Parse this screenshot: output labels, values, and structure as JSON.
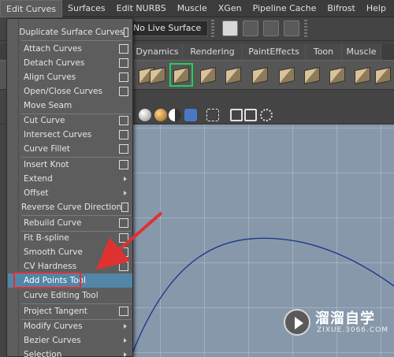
{
  "menubar": {
    "items": [
      {
        "label": "Edit Curves",
        "active": true
      },
      {
        "label": "Surfaces"
      },
      {
        "label": "Edit NURBS"
      },
      {
        "label": "Muscle"
      },
      {
        "label": "XGen"
      },
      {
        "label": "Pipeline Cache"
      },
      {
        "label": "Bifrost"
      },
      {
        "label": "Help"
      }
    ]
  },
  "statusline": {
    "live_surface": "No Live Surface"
  },
  "shelf": {
    "tabs": [
      "Dynamics",
      "Rendering",
      "PaintEffects",
      "Toon",
      "Muscle"
    ]
  },
  "menu": {
    "items": [
      {
        "label": "Duplicate Surface Curves",
        "kind": "option"
      },
      {
        "label": "Attach Curves",
        "kind": "option"
      },
      {
        "label": "Detach Curves",
        "kind": "option"
      },
      {
        "label": "Align Curves",
        "kind": "option"
      },
      {
        "label": "Open/Close Curves",
        "kind": "option"
      },
      {
        "label": "Move Seam",
        "kind": "plain"
      },
      {
        "label": "Cut Curve",
        "kind": "option"
      },
      {
        "label": "Intersect Curves",
        "kind": "option"
      },
      {
        "label": "Curve Fillet",
        "kind": "option"
      },
      {
        "label": "Insert Knot",
        "kind": "option"
      },
      {
        "label": "Extend",
        "kind": "submenu"
      },
      {
        "label": "Offset",
        "kind": "submenu"
      },
      {
        "label": "Reverse Curve Direction",
        "kind": "option"
      },
      {
        "label": "Rebuild Curve",
        "kind": "option"
      },
      {
        "label": "Fit B-spline",
        "kind": "option"
      },
      {
        "label": "Smooth Curve",
        "kind": "option"
      },
      {
        "label": "CV Hardness",
        "kind": "option"
      },
      {
        "label": "Add Points Tool",
        "kind": "plain",
        "highlighted": true
      },
      {
        "label": "Curve Editing Tool",
        "kind": "plain"
      },
      {
        "label": "Project Tangent",
        "kind": "option"
      },
      {
        "label": "Modify Curves",
        "kind": "submenu"
      },
      {
        "label": "Bezier Curves",
        "kind": "submenu"
      },
      {
        "label": "Selection",
        "kind": "submenu"
      }
    ]
  },
  "watermark": {
    "title": "溜溜自学",
    "url": "ZIXUE.3066.COM"
  },
  "colors": {
    "highlight": "#5285a6",
    "annotation_red": "#e03131",
    "viewport_bg": "#8798ab",
    "curve": "#1f3c8c"
  }
}
